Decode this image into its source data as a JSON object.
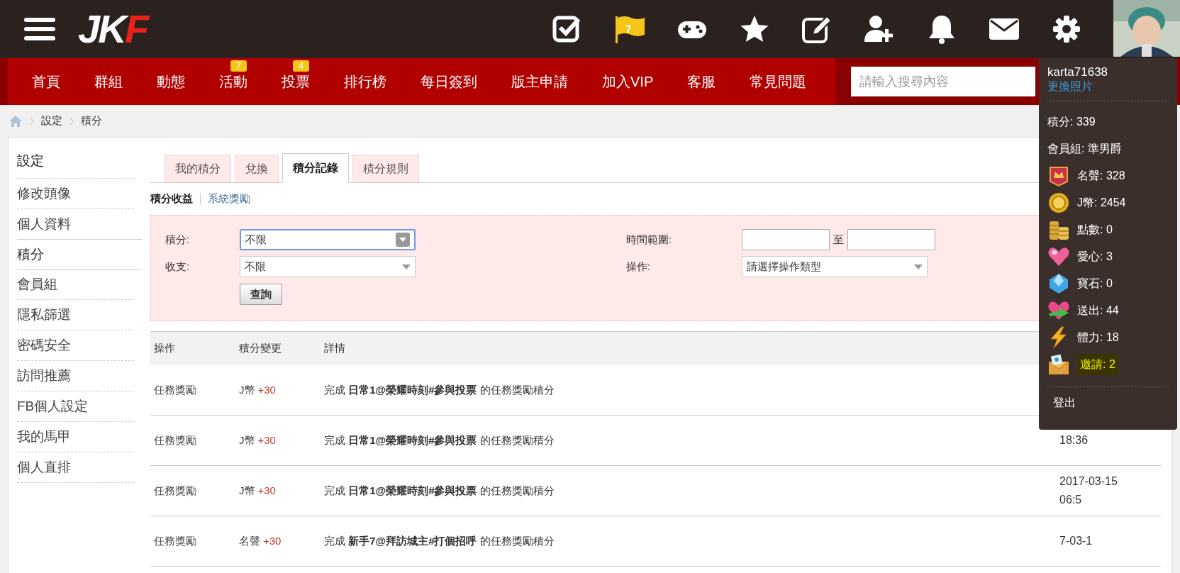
{
  "top_bar": {
    "logo": "JKF",
    "flag_badge": "7"
  },
  "nav": {
    "items": [
      {
        "label": "首頁"
      },
      {
        "label": "群組"
      },
      {
        "label": "動態"
      },
      {
        "label": "活動",
        "badge": "7"
      },
      {
        "label": "投票",
        "badge": "4"
      },
      {
        "label": "排行榜"
      },
      {
        "label": "每日簽到"
      },
      {
        "label": "版主申請"
      },
      {
        "label": "加入VIP"
      },
      {
        "label": "客服"
      },
      {
        "label": "常見問題"
      }
    ],
    "search_placeholder": "請輸入搜尋內容"
  },
  "breadcrumb": [
    "設定",
    "積分"
  ],
  "sidebar": {
    "title": "設定",
    "items": [
      {
        "label": "修改頭像",
        "selected": false
      },
      {
        "label": "個人資料",
        "selected": false
      },
      {
        "label": "積分",
        "selected": true
      },
      {
        "label": "會員組",
        "selected": false
      },
      {
        "label": "隱私篩選",
        "selected": false
      },
      {
        "label": "密碼安全",
        "selected": false
      },
      {
        "label": "訪問推薦",
        "selected": false
      },
      {
        "label": "FB個人設定",
        "selected": false
      },
      {
        "label": "我的馬甲",
        "selected": false
      },
      {
        "label": "個人直排",
        "selected": false
      }
    ]
  },
  "tabs": [
    {
      "label": "我的積分",
      "selected": false
    },
    {
      "label": "兌換",
      "selected": false
    },
    {
      "label": "積分記錄",
      "selected": true
    },
    {
      "label": "積分規則",
      "selected": false
    }
  ],
  "subtabs": [
    {
      "label": "積分收益",
      "selected": true
    },
    {
      "label": "系統獎勵",
      "selected": false
    }
  ],
  "filters": {
    "credit_label": "積分:",
    "credit_value": "不限",
    "credit_focused": true,
    "balance_label": "收支:",
    "balance_value": "不限",
    "time_label": "時間範圍:",
    "time_separator": "至",
    "operation_label": "操作:",
    "operation_value": "請選擇操作類型",
    "query_button": "查詢"
  },
  "table": {
    "columns": [
      "操作",
      "積分變更",
      "詳情"
    ],
    "rows": [
      {
        "operation": "任務獎勵",
        "change_type": "J幣",
        "change_amount": "+30",
        "detail": "完成 **日常1@榮耀時刻#參與投票** 的任務獎勵積分",
        "date_lines": []
      },
      {
        "operation": "任務獎勵",
        "change_type": "J幣",
        "change_amount": "+30",
        "detail": "完成 **日常1@榮耀時刻#參與投票** 的任務獎勵積分",
        "date_lines": [
          "18:36"
        ]
      },
      {
        "operation": "任務獎勵",
        "change_type": "J幣",
        "change_amount": "+30",
        "detail": "完成 **日常1@榮耀時刻#參與投票** 的任務獎勵積分",
        "date_lines": [
          "2017-03-15",
          "06:5"
        ]
      },
      {
        "operation": "任務獎勵",
        "change_type": "名聲",
        "change_amount": "+30",
        "detail": "完成 **新手7@拜訪城主#打個招呼** 的任務獎勵積分",
        "date_lines": [
          "7-03-1"
        ]
      }
    ]
  },
  "user_menu": {
    "username": "karta71638",
    "change_photo": "更換照片",
    "stats": [
      {
        "kind": "plain",
        "text": "積分: 339",
        "highlighted": false
      },
      {
        "kind": "plain",
        "text": "會員組: 準男爵",
        "highlighted": false
      },
      {
        "kind": "icon",
        "text": "名聲: 328",
        "highlighted": false
      },
      {
        "kind": "icon",
        "text": "J幣: 2454",
        "highlighted": false
      },
      {
        "kind": "icon",
        "text": "點數: 0",
        "highlighted": false
      },
      {
        "kind": "icon",
        "text": "愛心: 3",
        "highlighted": false
      },
      {
        "kind": "icon",
        "text": "寶石: 0",
        "highlighted": false
      },
      {
        "kind": "icon",
        "text": "送出: 44",
        "highlighted": false
      },
      {
        "kind": "icon",
        "text": "體力: 18",
        "highlighted": false
      },
      {
        "kind": "icon",
        "text": "邀請: 2",
        "highlighted": true
      }
    ],
    "logout": "登出"
  }
}
